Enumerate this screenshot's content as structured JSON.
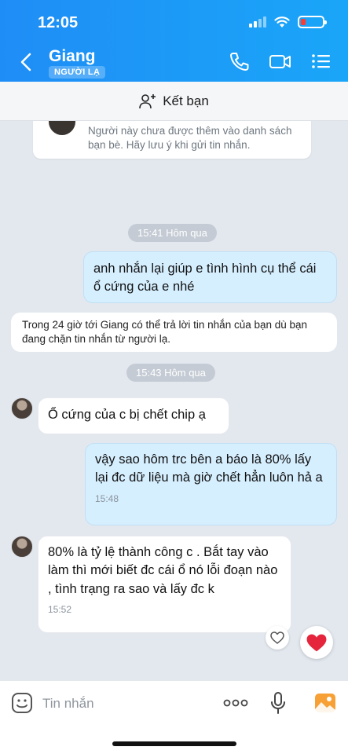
{
  "status_bar": {
    "time": "12:05",
    "battery_level": 0.2,
    "battery_color": "#ff3b30"
  },
  "header": {
    "contact_name": "Giang",
    "badge": "NGƯỜI LẠ",
    "icons": [
      "back-icon",
      "phone-icon",
      "video-icon",
      "menu-icon"
    ]
  },
  "add_friend": {
    "label": "Kết bạn",
    "icon": "add-user-icon"
  },
  "notice": {
    "text": "Người này chưa được thêm vào danh sách bạn bè. Hãy lưu ý khi gửi tin nhắn."
  },
  "system_note": {
    "text": "Trong 24 giờ tới Giang có thể trả lời tin nhắn của bạn dù bạn đang chặn tin nhắn từ người lạ."
  },
  "messages": [
    {
      "type": "time",
      "text": "15:41 Hôm qua"
    },
    {
      "type": "out",
      "text": "anh nhắn lại giúp e tình hình cụ thể cái ổ cứng của e nhé"
    },
    {
      "type": "time",
      "text": "15:43 Hôm qua"
    },
    {
      "type": "in",
      "text": "Ổ cứng của c  bị chết chip ạ"
    },
    {
      "type": "out",
      "text": "vậy sao hôm trc bên a báo là 80% lấy lại đc dữ liệu mà giờ chết hẳn luôn hả a",
      "time": "15:48"
    },
    {
      "type": "in",
      "text": "80% là tỷ lệ thành công c .  Bắt tay vào làm thì mới biết đc cái ổ nó lỗi đoạn nào , tình trạng ra sao và lấy đc k",
      "time": "15:52"
    }
  ],
  "reactions": {
    "heart_outline": "heart-outline-icon",
    "heart_filled": "heart-icon",
    "heart_color": "#e5253b"
  },
  "input": {
    "placeholder": "Tin nhắn"
  },
  "colors": {
    "header_start": "#1f8df6",
    "header_end": "#1aa6f8",
    "outgoing_bubble": "#d6efff",
    "chat_background": "#e3e8ef"
  }
}
